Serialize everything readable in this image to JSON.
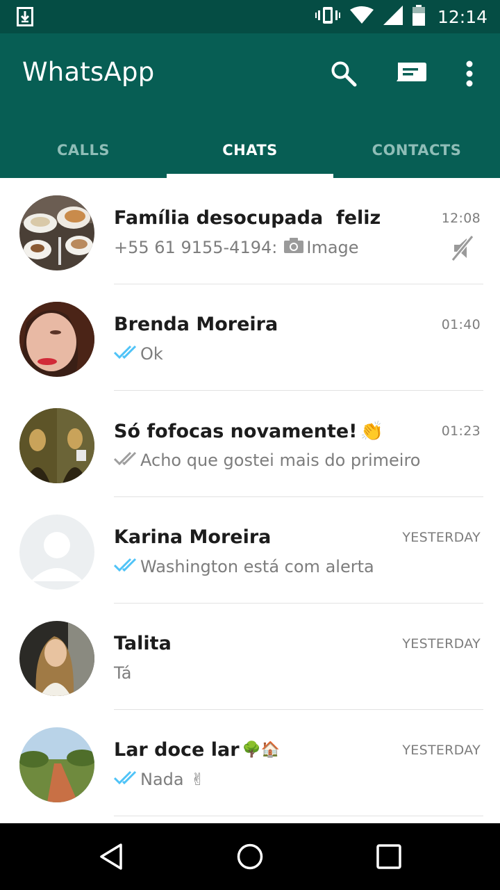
{
  "status_bar": {
    "time": "12:14",
    "icons": [
      "download-notification-icon",
      "vibrate-icon",
      "wifi-icon",
      "signal-icon",
      "battery-icon"
    ]
  },
  "app_bar": {
    "title": "WhatsApp",
    "actions": [
      "search-icon",
      "new-chat-icon",
      "overflow-menu-icon"
    ]
  },
  "tabs": [
    {
      "label": "CALLS",
      "active": false
    },
    {
      "label": "CHATS",
      "active": true
    },
    {
      "label": "CONTACTS",
      "active": false
    }
  ],
  "chats": [
    {
      "name": "Família desocupada  feliz",
      "name_emoji": "",
      "time": "12:08",
      "sender": "+55 61 9155-4194:",
      "message": "Image",
      "message_icon": "camera-icon",
      "ticks": "none",
      "muted": true
    },
    {
      "name": "Brenda Moreira",
      "name_emoji": "",
      "time": "01:40",
      "sender": "",
      "message": "Ok",
      "message_icon": "",
      "ticks": "read",
      "muted": false
    },
    {
      "name": "Só fofocas novamente!",
      "name_emoji": "👏",
      "time": "01:23",
      "sender": "",
      "message": "Acho que gostei mais do primeiro",
      "message_icon": "",
      "ticks": "delivered",
      "muted": false
    },
    {
      "name": "Karina Moreira",
      "name_emoji": "",
      "time": "YESTERDAY",
      "sender": "",
      "message": "Washington está com alerta",
      "message_icon": "",
      "ticks": "read",
      "muted": false
    },
    {
      "name": "Talita",
      "name_emoji": "",
      "time": "YESTERDAY",
      "sender": "",
      "message": "Tá",
      "message_icon": "",
      "ticks": "none",
      "muted": false
    },
    {
      "name": "Lar doce lar",
      "name_emoji": "🌳🏠",
      "time": "YESTERDAY",
      "sender": "",
      "message": "Nada",
      "message_emoji": "✌",
      "message_icon": "",
      "ticks": "read",
      "muted": false
    }
  ],
  "colors": {
    "status_bar": "#054d44",
    "app_bar": "#075e54",
    "tab_inactive": "#8fbdb7",
    "read_tick": "#4fc3f7",
    "delivered_tick": "#9e9e9e"
  },
  "nav_bar": [
    "back-icon",
    "home-icon",
    "recents-icon"
  ]
}
